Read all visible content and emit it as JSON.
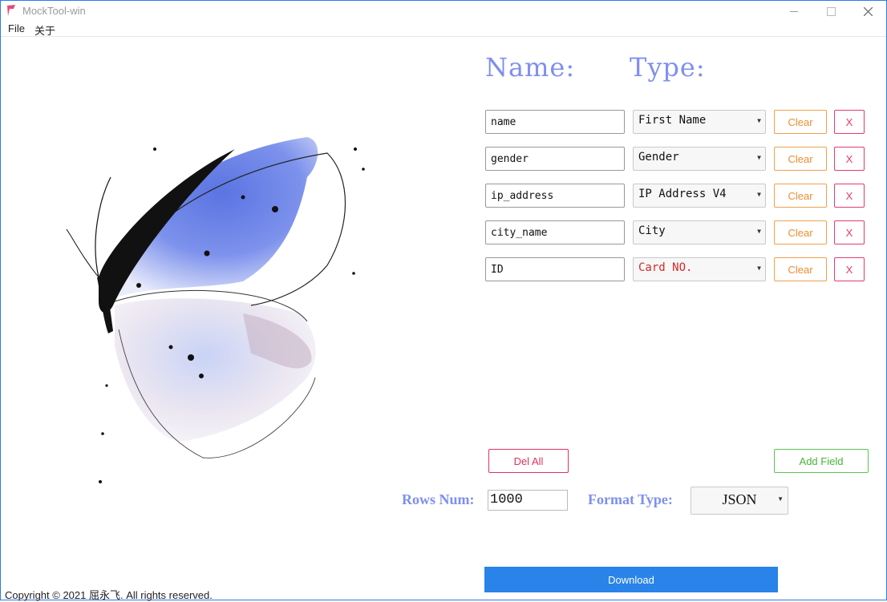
{
  "window": {
    "title": "MockTool-win",
    "accent": "#2b7de9"
  },
  "menu": {
    "items": [
      {
        "label": "File"
      },
      {
        "label": "关于"
      }
    ]
  },
  "headers": {
    "name": "Name:",
    "type": "Type:"
  },
  "fields": [
    {
      "name": "name",
      "type": "First Name",
      "highlight": false
    },
    {
      "name": "gender",
      "type": "Gender",
      "highlight": false
    },
    {
      "name": "ip_address",
      "type": "IP Address V4",
      "highlight": false
    },
    {
      "name": "city_name",
      "type": "City",
      "highlight": false
    },
    {
      "name": "ID",
      "type": "Card NO.",
      "highlight": true
    }
  ],
  "row_buttons": {
    "clear_label": "Clear",
    "remove_label": "X"
  },
  "actions": {
    "del_all_label": "Del All",
    "add_field_label": "Add Field",
    "download_label": "Download"
  },
  "options": {
    "rows_label": "Rows Num:",
    "rows_value": "1000",
    "format_label": "Format Type:",
    "format_value": "JSON"
  },
  "footer": {
    "copyright": "Copyright © 2021 屈永飞. All rights reserved."
  },
  "colors": {
    "header": "#7e8ff0",
    "clear": "#ef8d2f",
    "remove": "#e23b71",
    "add": "#45b33a",
    "download": "#2983e8",
    "highlight_type": "#d42a2a"
  }
}
